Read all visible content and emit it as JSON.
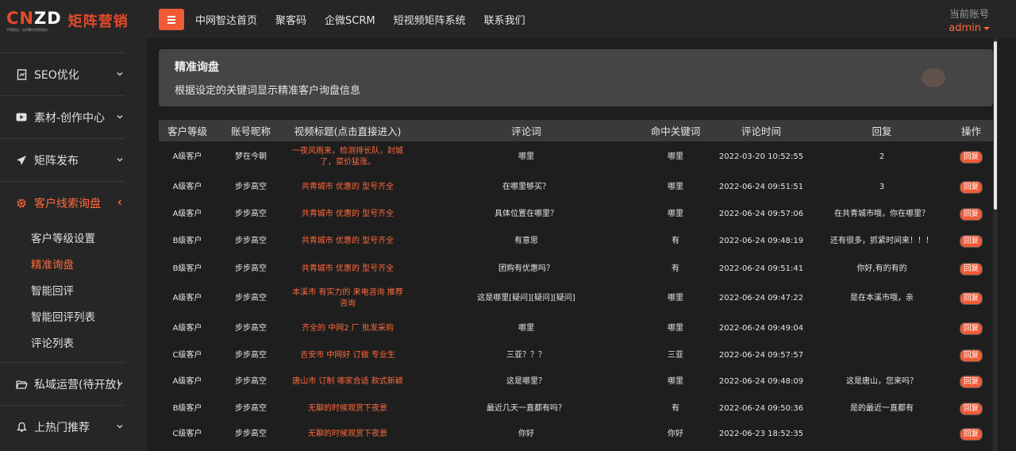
{
  "brand": {
    "mark_cn": "CN",
    "mark_zd": "ZD",
    "subtitle": "中网智达｜全网整合营销服务",
    "name": "矩阵营销"
  },
  "sidebar": {
    "items": [
      {
        "label": "SEO优化",
        "icon": "seo-doc-icon",
        "chevron": "chevron-down"
      },
      {
        "label": "素材-创作中心",
        "icon": "video-play-icon",
        "chevron": "chevron-down"
      },
      {
        "label": "矩阵发布",
        "icon": "send-icon",
        "chevron": "chevron-down"
      },
      {
        "label": "客户线索询盘",
        "icon": "gear-icon",
        "chevron": "chevron-left",
        "active": true,
        "children": [
          "客户等级设置",
          "精准询盘",
          "智能回评",
          "智能回评列表",
          "评论列表"
        ]
      },
      {
        "label": "私域运营(待开放)",
        "icon": "folder-open-icon",
        "chevron": "chevron-down"
      },
      {
        "label": "上热门推荐",
        "icon": "bell-icon",
        "chevron": "chevron-down"
      }
    ],
    "active_child_index": 1
  },
  "topbar": {
    "links": [
      "中网智达首页",
      "聚客码",
      "企微SCRM",
      "短视频矩阵系统",
      "联系我们"
    ],
    "account_label": "当前账号",
    "account_user": "admin"
  },
  "page": {
    "title": "精准询盘",
    "description": "根据设定的关键词显示精准客户询盘信息"
  },
  "table": {
    "columns": [
      "客户等级",
      "账号昵称",
      "视频标题(点击直接进入)",
      "评论词",
      "命中关键词",
      "评论时间",
      "回复",
      "操作"
    ],
    "action_label": "回复",
    "rows": [
      {
        "level": "A级客户",
        "nick": "梦在今朝",
        "title": "一夜风雨来，检测排长队，封城了，菜价猛涨。",
        "comment": "哪里",
        "keyword": "哪里",
        "time": "2022-03-20 10:52:55",
        "reply": "2"
      },
      {
        "level": "A级客户",
        "nick": "步步高空",
        "title": "共青城市 优惠的 型号齐全",
        "comment": "在哪里够买？",
        "keyword": "哪里",
        "time": "2022-06-24 09:51:51",
        "reply": "3"
      },
      {
        "level": "A级客户",
        "nick": "步步高空",
        "title": "共青城市 优惠的 型号齐全",
        "comment": "具体位置在哪里？",
        "keyword": "哪里",
        "time": "2022-06-24 09:57:06",
        "reply": "在共青城市哦，你在哪里？"
      },
      {
        "level": "B级客户",
        "nick": "步步高空",
        "title": "共青城市 优惠的 型号齐全",
        "comment": "有意思",
        "keyword": "有",
        "time": "2022-06-24 09:48:19",
        "reply": "还有很多，抓紧时间来！！！"
      },
      {
        "level": "B级客户",
        "nick": "步步高空",
        "title": "共青城市 优惠的 型号齐全",
        "comment": "团购有优惠吗？",
        "keyword": "有",
        "time": "2022-06-24 09:51:41",
        "reply": "你好,有的有的"
      },
      {
        "level": "A级客户",
        "nick": "步步高空",
        "title": "本溪市 有实力的 来电咨询 推荐咨询",
        "comment": "这是哪里[疑问][疑问][疑问]",
        "keyword": "哪里",
        "time": "2022-06-24 09:47:22",
        "reply": "是在本溪市哦，亲"
      },
      {
        "level": "A级客户",
        "nick": "步步高空",
        "title": "齐全的 中网2 厂 批发采购",
        "comment": "哪里",
        "keyword": "哪里",
        "time": "2022-06-24 09:49:04",
        "reply": ""
      },
      {
        "level": "C级客户",
        "nick": "步步高空",
        "title": "吉安市 中网好 订做 专业生",
        "comment": "三亚？？？",
        "keyword": "三亚",
        "time": "2022-06-24 09:57:57",
        "reply": ""
      },
      {
        "level": "A级客户",
        "nick": "步步高空",
        "title": "唐山市 订制 哪家合适 款式新颖",
        "comment": "这是哪里？",
        "keyword": "哪里",
        "time": "2022-06-24 09:48:09",
        "reply": "这是唐山，您来吗？"
      },
      {
        "level": "B级客户",
        "nick": "步步高空",
        "title": "无聊的时候观赏下夜景",
        "comment": "最近几天一直都有吗？",
        "keyword": "有",
        "time": "2022-06-24 09:50:36",
        "reply": "是的最近一直都有"
      },
      {
        "level": "C级客户",
        "nick": "步步高空",
        "title": "无聊的时候观赏下夜景",
        "comment": "你好",
        "keyword": "你好",
        "time": "2022-06-23 18:52:35",
        "reply": ""
      }
    ]
  },
  "colors": {
    "accent": "#f05a36",
    "accent_text": "#ff6a3d",
    "sidebar_bg": "#262626",
    "body_bg": "#1e1e1e"
  }
}
